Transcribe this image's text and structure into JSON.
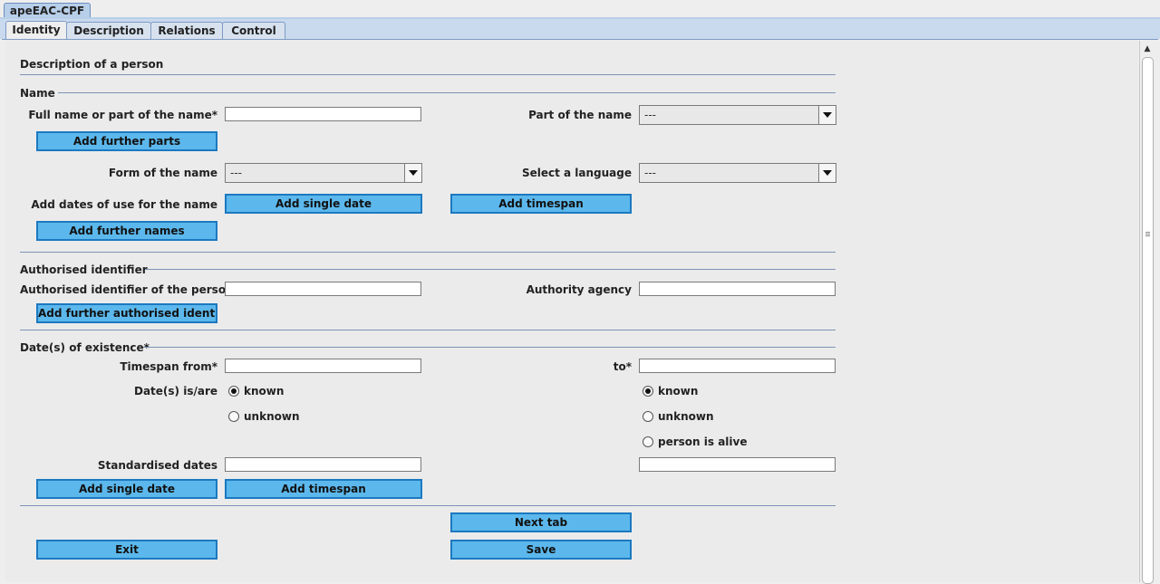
{
  "window": {
    "outer_tab": "apeEAC-CPF"
  },
  "tabs": [
    "Identity",
    "Description",
    "Relations",
    "Control"
  ],
  "section_title": "Description of a person",
  "name_section": {
    "title": "Name",
    "full_name_label": "Full name or part of the name*",
    "full_name_value": "",
    "part_of_name_label": "Part of the name",
    "part_of_name_value": "---",
    "add_further_parts": "Add further parts",
    "form_label": "Form of the name",
    "form_value": "---",
    "language_label": "Select a language",
    "language_value": "---",
    "dates_label": "Add dates of use for the name",
    "add_single_date": "Add single date",
    "add_timespan": "Add timespan",
    "add_further_names": "Add further names"
  },
  "authorised_section": {
    "title": "Authorised identifier",
    "identifier_label": "Authorised identifier of the person",
    "identifier_value": "",
    "agency_label": "Authority agency",
    "agency_value": "",
    "add_further": "Add further authorised identi..."
  },
  "existence_section": {
    "title": "Date(s) of existence*",
    "from_label": "Timespan from*",
    "from_value": "",
    "to_label": "to*",
    "to_value": "",
    "status_label": "Date(s) is/are",
    "left_known": "known",
    "left_unknown": "unknown",
    "right_known": "known",
    "right_unknown": "unknown",
    "right_alive": "person is alive",
    "standardised_label": "Standardised dates",
    "standardised_from": "",
    "standardised_to": "",
    "add_single_date": "Add single date",
    "add_timespan": "Add timespan"
  },
  "footer": {
    "next_tab": "Next tab",
    "exit": "Exit",
    "save": "Save"
  }
}
